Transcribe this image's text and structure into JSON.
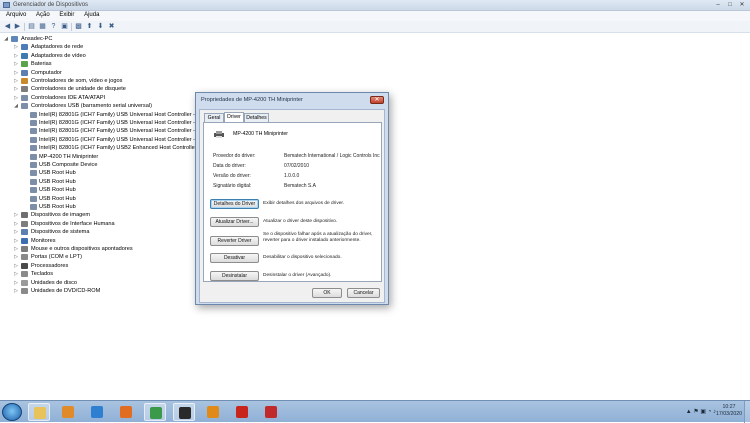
{
  "window": {
    "title": "Gerenciador de Dispositivos",
    "menu": [
      "Arquivo",
      "Ação",
      "Exibir",
      "Ajuda"
    ],
    "controls": [
      "–",
      "□",
      "✕"
    ]
  },
  "tree": {
    "root": "Ansadec-PC",
    "categories": [
      {
        "label": "Adaptadores de rede",
        "color": "#4d7cb8"
      },
      {
        "label": "Adaptadores de vídeo",
        "color": "#3d7bb0"
      },
      {
        "label": "Baterias",
        "color": "#5aa34a"
      },
      {
        "label": "Computador",
        "color": "#5a7fb0"
      },
      {
        "label": "Controladores de som, vídeo e jogos",
        "color": "#c98a2e"
      },
      {
        "label": "Controladores de unidade de disquete",
        "color": "#7d7d7d"
      },
      {
        "label": "Controladores IDE ATA/ATAPI",
        "color": "#7d8ea8"
      },
      {
        "label": "Controladores USB (barramento serial universal)",
        "color": "#7d8ea8"
      }
    ],
    "usb_children": [
      "Intel(R) 82801G (ICH7 Family) USB Universal Host Controller - 2",
      "Intel(R) 82801G (ICH7 Family) USB Universal Host Controller - 2",
      "Intel(R) 82801G (ICH7 Family) USB Universal Host Controller - 2",
      "Intel(R) 82801G (ICH7 Family) USB Universal Host Controller - 2",
      "Intel(R) 82801G (ICH7 Family) USB2 Enhanced Host Controller -",
      "MP-4200 TH Miniprinter",
      "USB Composite Device",
      "USB Root Hub",
      "USB Root Hub",
      "USB Root Hub",
      "USB Root Hub",
      "USB Root Hub"
    ],
    "more_categories": [
      {
        "label": "Dispositivos de imagem",
        "color": "#6f6f6f"
      },
      {
        "label": "Dispositivos de Interface Humana",
        "color": "#7d7d7d"
      },
      {
        "label": "Dispositivos de sistema",
        "color": "#5a7fb0"
      },
      {
        "label": "Monitores",
        "color": "#3d6fb0"
      },
      {
        "label": "Mouse e outros dispositivos apontadores",
        "color": "#7d7d7d"
      },
      {
        "label": "Portas (COM e LPT)",
        "color": "#8a8a8a"
      },
      {
        "label": "Processadores",
        "color": "#4a4a4a"
      },
      {
        "label": "Teclados",
        "color": "#8a8a8a"
      },
      {
        "label": "Unidades de disco",
        "color": "#9a9a9a"
      },
      {
        "label": "Unidades de DVD/CD-ROM",
        "color": "#8a8a8a"
      }
    ]
  },
  "dialog": {
    "title": "Propriedades de MP-4200 TH Miniprinter",
    "close": "✕",
    "tabs": [
      "Geral",
      "Driver",
      "Detalhes"
    ],
    "active_tab": "Driver",
    "device_name": "MP-4200 TH Miniprinter",
    "props": [
      {
        "label": "Provedor do driver:",
        "value": "Bematech International / Logic Controls Inc"
      },
      {
        "label": "Data do driver:",
        "value": "07/02/2010"
      },
      {
        "label": "Versão do driver:",
        "value": "1.0.0.0"
      },
      {
        "label": "Signatário digital:",
        "value": "Bematech S.A"
      }
    ],
    "actions": [
      {
        "button": "Detalhes do Driver",
        "desc": "Exibir detalhes dos arquivos de driver."
      },
      {
        "button": "Atualizar Driver...",
        "desc": "Atualizar o driver deste dispositivo."
      },
      {
        "button": "Reverter Driver",
        "desc": "Se o dispositivo falhar após a atualização do driver, reverter para o driver instalado anteriormente."
      },
      {
        "button": "Desativar",
        "desc": "Desabilitar o dispositivo selecionado."
      },
      {
        "button": "Desinstalar",
        "desc": "Desinstalar o driver (Avançado)."
      }
    ],
    "ok": "OK",
    "cancel": "Cancelar"
  },
  "taskbar": {
    "items": [
      {
        "name": "explorer-icon",
        "color": "#e8c25a"
      },
      {
        "name": "media-player-icon",
        "color": "#e08a2a"
      },
      {
        "name": "internet-explorer-icon",
        "color": "#2f7fd1"
      },
      {
        "name": "firefox-icon",
        "color": "#e06d22"
      },
      {
        "name": "chrome-icon",
        "color": "#3a9a4a"
      },
      {
        "name": "terminal-icon",
        "color": "#2a2a2a"
      },
      {
        "name": "outlook-icon",
        "color": "#e08a1a"
      },
      {
        "name": "acrobat-icon",
        "color": "#c8261c"
      },
      {
        "name": "toolbox-icon",
        "color": "#c02a2a"
      }
    ],
    "time": "10:27",
    "date": "17/03/2020"
  }
}
